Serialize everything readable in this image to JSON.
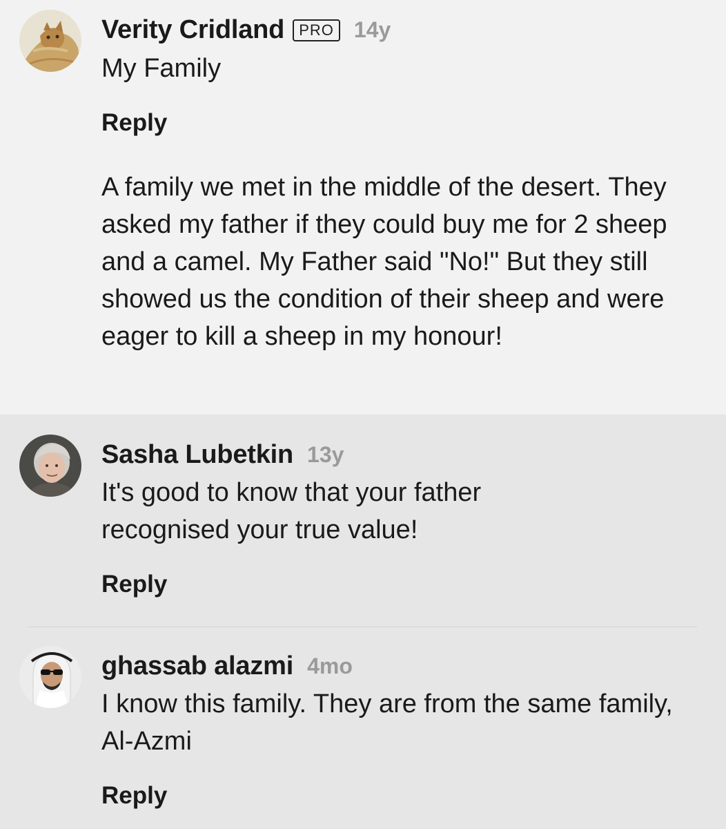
{
  "post": {
    "author": "Verity Cridland",
    "badge": "PRO",
    "time": "14y",
    "title": "My Family",
    "reply_label": "Reply",
    "description": "A family we met in the middle of the desert. They asked my father if they could buy me for 2 sheep and a camel. My Father said \"No!\" But they still showed us the condition of their sheep and were eager to kill a sheep in my honour!",
    "avatar_icon": "cat-avatar-icon"
  },
  "comments": [
    {
      "author": "Sasha Lubetkin",
      "time": "13y",
      "text": "It's good to know that your father recognised your true value!",
      "reply_label": "Reply",
      "avatar_icon": "woman-avatar-icon"
    },
    {
      "author": "ghassab alazmi",
      "time": "4mo",
      "text": "I know this family. They are from the same family, Al-Azmi",
      "reply_label": "Reply",
      "avatar_icon": "man-sunglasses-avatar-icon"
    }
  ]
}
